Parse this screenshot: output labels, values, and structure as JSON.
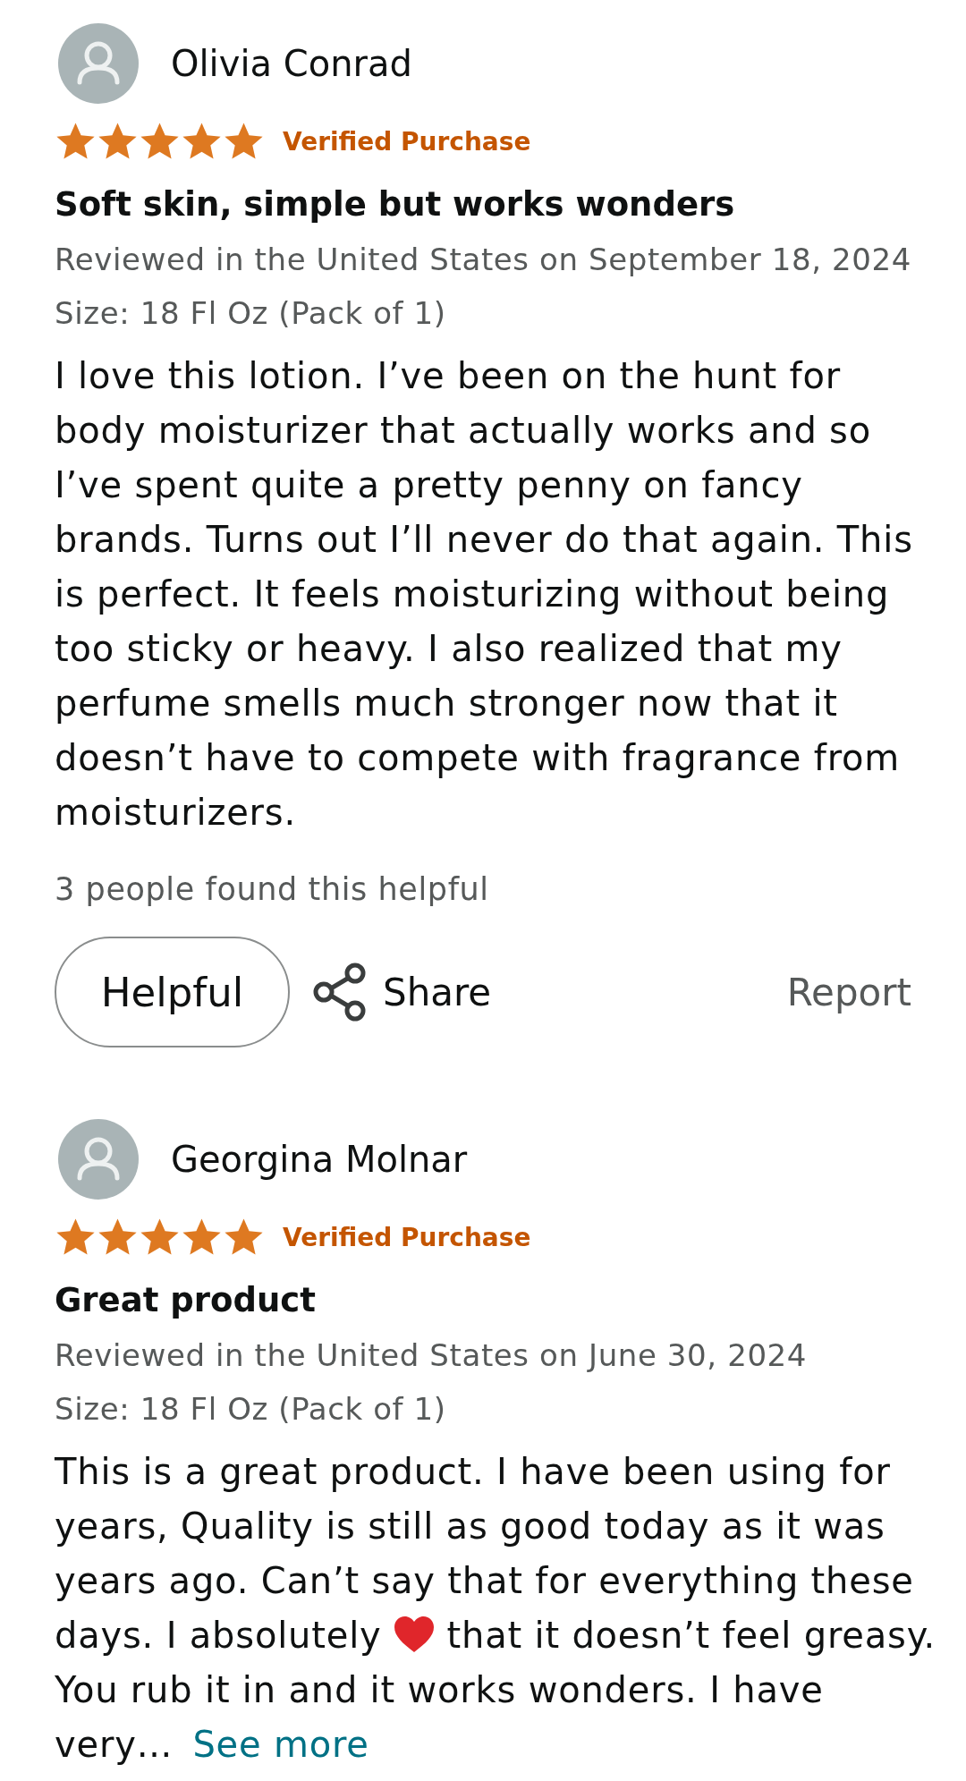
{
  "reviews": [
    {
      "author": "Olivia Conrad",
      "stars": 5,
      "badge": "Verified Purchase",
      "title": "Soft skin, simple but works wonders",
      "reviewed": "Reviewed in the United States on September 18, 2024",
      "variant": "Size: 18 Fl Oz (Pack of 1)",
      "body": [
        {
          "kind": "text",
          "text": "I love this lotion. I’ve been on the hunt for body moisturizer that actually works and so I’ve spent quite a pretty penny on fancy brands. Turns out I’ll never do that again. This is perfect. It feels moisturizing without being too sticky or heavy. I also realized that my perfume smells much stronger now that it doesn’t have to compete with fragrance from moisturizers."
        }
      ],
      "helpful_count": "3 people found this helpful",
      "actions": {
        "helpful": "Helpful",
        "share": "Share",
        "report": "Report"
      }
    },
    {
      "author": "Georgina Molnar",
      "stars": 5,
      "badge": "Verified Purchase",
      "title": "Great product",
      "reviewed": "Reviewed in the United States on June 30, 2024",
      "variant": "Size: 18 Fl Oz (Pack of 1)",
      "body": [
        {
          "kind": "text",
          "text": "This is a great product. I have been using for years, Quality is still as good today as it was years ago. Can’t say that for everything these days. I absolutely"
        },
        {
          "kind": "emoji"
        },
        {
          "kind": "text",
          "text": "that it doesn’t feel greasy. You rub it in and it works wonders. I have very…"
        }
      ],
      "see_more": "See more"
    }
  ]
}
